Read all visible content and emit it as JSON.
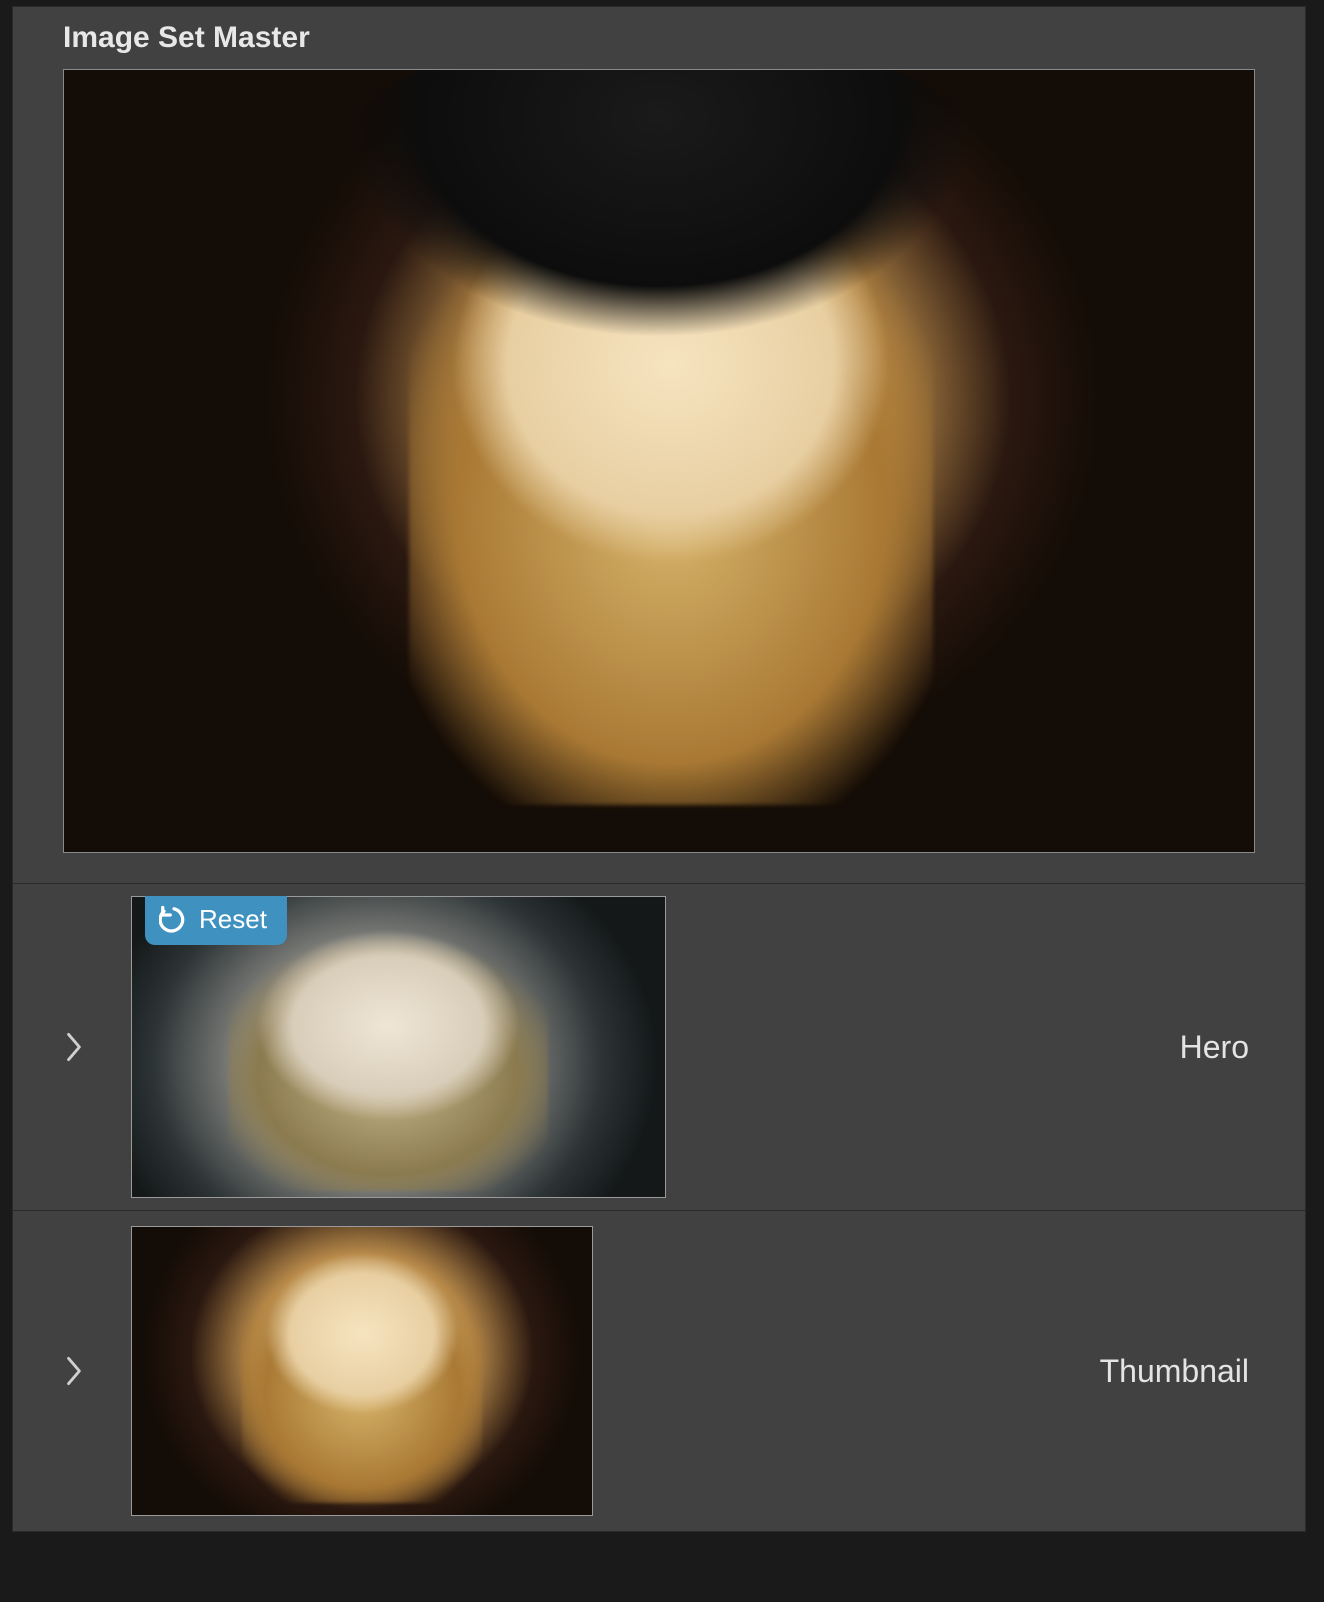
{
  "master": {
    "title": "Image Set Master"
  },
  "rows": [
    {
      "label": "Hero",
      "reset_label": "Reset",
      "has_reset": true
    },
    {
      "label": "Thumbnail",
      "has_reset": false
    }
  ]
}
